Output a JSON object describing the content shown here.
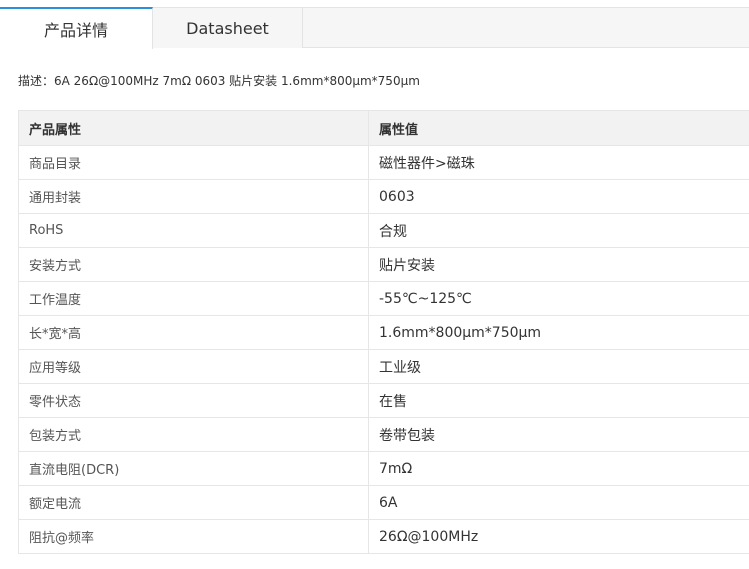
{
  "tabs": [
    {
      "label": "产品详情",
      "active": true
    },
    {
      "label": "Datasheet",
      "active": false
    }
  ],
  "description": {
    "label": "描述：",
    "text": "6A 26Ω@100MHz 7mΩ 0603 贴片安装 1.6mm*800μm*750μm"
  },
  "table": {
    "headers": [
      "产品属性",
      "属性值"
    ],
    "rows": [
      {
        "name": "商品目录",
        "value": "磁性器件>磁珠"
      },
      {
        "name": "通用封装",
        "value": "0603"
      },
      {
        "name": "RoHS",
        "value": "合规"
      },
      {
        "name": "安装方式",
        "value": "贴片安装"
      },
      {
        "name": "工作温度",
        "value": "-55℃~125℃"
      },
      {
        "name": "长*宽*高",
        "value": "1.6mm*800μm*750μm"
      },
      {
        "name": "应用等级",
        "value": "工业级"
      },
      {
        "name": "零件状态",
        "value": "在售"
      },
      {
        "name": "包装方式",
        "value": "卷带包装"
      },
      {
        "name": "直流电阻(DCR)",
        "value": "7mΩ"
      },
      {
        "name": "额定电流",
        "value": "6A"
      },
      {
        "name": "阻抗@频率",
        "value": "26Ω@100MHz"
      }
    ]
  },
  "colors": {
    "accent": "#2a90d9",
    "header_bg": "#f2f2f2",
    "border": "#e6e6e6"
  }
}
